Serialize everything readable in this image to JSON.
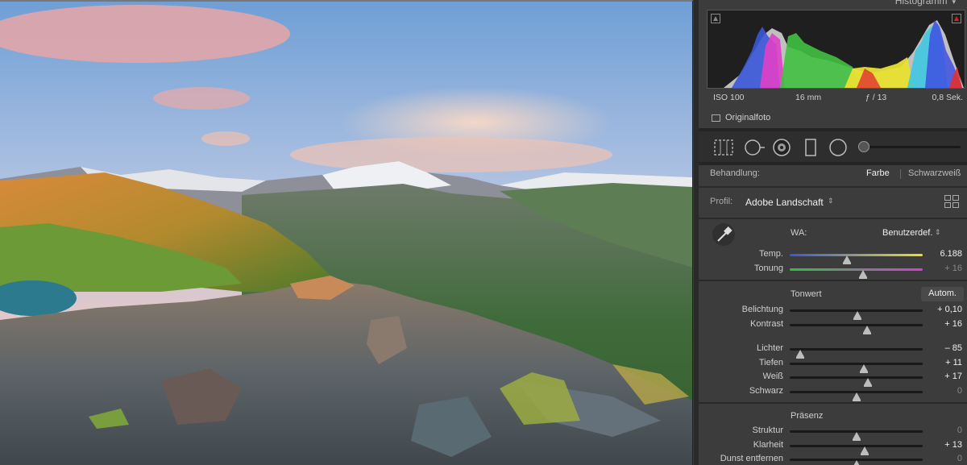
{
  "panel": {
    "title": "Histogramm",
    "meta": {
      "iso": "ISO 100",
      "focal": "16 mm",
      "aperture": "ƒ / 13",
      "shutter": "0,8 Sek."
    },
    "original_photo_label": "Originalfoto",
    "tools": [
      "crop-icon",
      "spot-removal-icon",
      "redeye-icon",
      "graduated-filter-icon",
      "radial-filter-icon",
      "brush-icon"
    ],
    "treatment": {
      "label": "Behandlung:",
      "option_color": "Farbe",
      "option_bw": "Schwarzweiß"
    },
    "profile": {
      "label": "Profil:",
      "value": "Adobe Landschaft"
    },
    "white_balance": {
      "label": "WA:",
      "value": "Benutzerdef."
    },
    "sliders": {
      "temp": {
        "label": "Temp.",
        "value": "6.188",
        "position": 0.43
      },
      "tint": {
        "label": "Tonung",
        "value": "+ 16",
        "position": 0.55
      },
      "exposure": {
        "label": "Belichtung",
        "value": "+ 0,10",
        "position": 0.51
      },
      "contrast": {
        "label": "Kontrast",
        "value": "+ 16",
        "position": 0.58
      },
      "highlights": {
        "label": "Lichter",
        "value": "– 85",
        "position": 0.08
      },
      "shadows": {
        "label": "Tiefen",
        "value": "+ 11",
        "position": 0.555
      },
      "whites": {
        "label": "Weiß",
        "value": "+ 17",
        "position": 0.585
      },
      "blacks": {
        "label": "Schwarz",
        "value": "0",
        "position": 0.5
      },
      "texture": {
        "label": "Struktur",
        "value": "0",
        "position": 0.5
      },
      "clarity": {
        "label": "Klarheit",
        "value": "+ 13",
        "position": 0.565
      },
      "dehaze": {
        "label": "Dunst entfernen",
        "value": "0",
        "position": 0.5
      }
    },
    "tone_section": {
      "title": "Tonwert",
      "auto_label": "Autom."
    },
    "presence_section": {
      "title": "Präsenz"
    }
  },
  "colors": {
    "panel_bg": "#3c3c3c",
    "histogram_bg": "#1f1f1f",
    "clip_warning": "#e02020"
  }
}
